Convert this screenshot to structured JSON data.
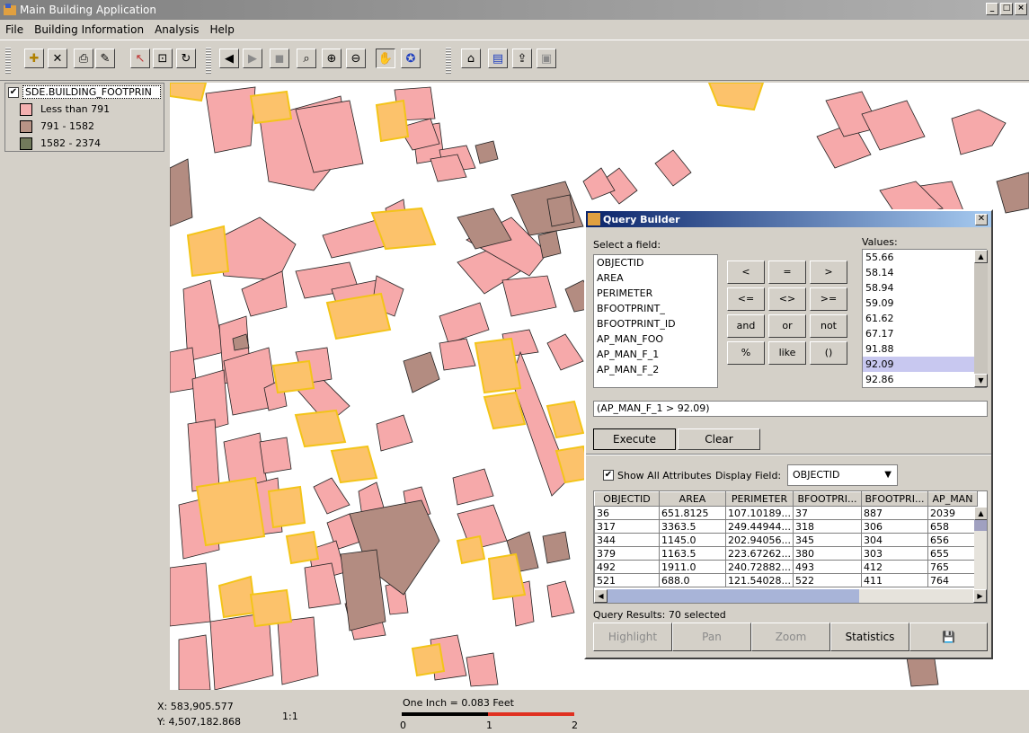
{
  "window": {
    "title": "Main Building Application",
    "buttons": [
      "_",
      "□",
      "×"
    ]
  },
  "menu": [
    "File",
    "Building Information",
    "Analysis",
    "Help"
  ],
  "legend": {
    "layer": "SDE.BUILDING_FOOTPRIN",
    "classes": [
      {
        "label": "Less than 791",
        "color": "#f4b0b0"
      },
      {
        "label": "791 - 1582",
        "color": "#b89486"
      },
      {
        "label": "1582 - 2374",
        "color": "#727a5c"
      }
    ]
  },
  "colors": {
    "building_low": "#f6a9aa",
    "building_mid": "#b38c81",
    "building_selected": "#fcc26b",
    "selection_outline": "#f3c419"
  },
  "query": {
    "title": "Query Builder",
    "select_field_label": "Select a field:",
    "fields": [
      "OBJECTID",
      "AREA",
      "PERIMETER",
      "BFOOTPRINT_",
      "BFOOTPRINT_ID",
      "AP_MAN_FOO",
      "AP_MAN_F_1",
      "AP_MAN_F_2"
    ],
    "values_label": "Values:",
    "values": [
      "55.66",
      "58.14",
      "58.94",
      "59.09",
      "61.62",
      "67.17",
      "91.88",
      "92.09",
      "92.86"
    ],
    "selected_value": "92.09",
    "operators": [
      "<",
      "=",
      ">",
      "<=",
      "<>",
      ">=",
      "and",
      "or",
      "not",
      "%",
      "like",
      "()"
    ],
    "expression": "(AP_MAN_F_1 > 92.09)",
    "execute": "Execute",
    "clear": "Clear",
    "show_all": "Show All Attributes",
    "display_field_label": "Display Field:",
    "display_field": "OBJECTID",
    "columns": [
      "OBJECTID",
      "AREA",
      "PERIMETER",
      "BFOOTPRI...",
      "BFOOTPRI...",
      "AP_MAN"
    ],
    "rows": [
      [
        "36",
        "651.8125",
        "107.10189...",
        "37",
        "887",
        "2039"
      ],
      [
        "317",
        "3363.5",
        "249.44944...",
        "318",
        "306",
        "658"
      ],
      [
        "344",
        "1145.0",
        "202.94056...",
        "345",
        "304",
        "656"
      ],
      [
        "379",
        "1163.5",
        "223.67262...",
        "380",
        "303",
        "655"
      ],
      [
        "492",
        "1911.0",
        "240.72882...",
        "493",
        "412",
        "765"
      ],
      [
        "521",
        "688.0",
        "121.54028...",
        "522",
        "411",
        "764"
      ]
    ],
    "results": "Query Results: 70 selected",
    "buttons": [
      "Highlight",
      "Pan",
      "Zoom",
      "Statistics"
    ]
  },
  "status": {
    "x": "X: 583,905.577",
    "y": "Y: 4,507,182.868",
    "scale": "1:1",
    "scalebar": "One Inch = 0.083 Feet",
    "ticks": [
      "0",
      "1",
      "2"
    ]
  }
}
